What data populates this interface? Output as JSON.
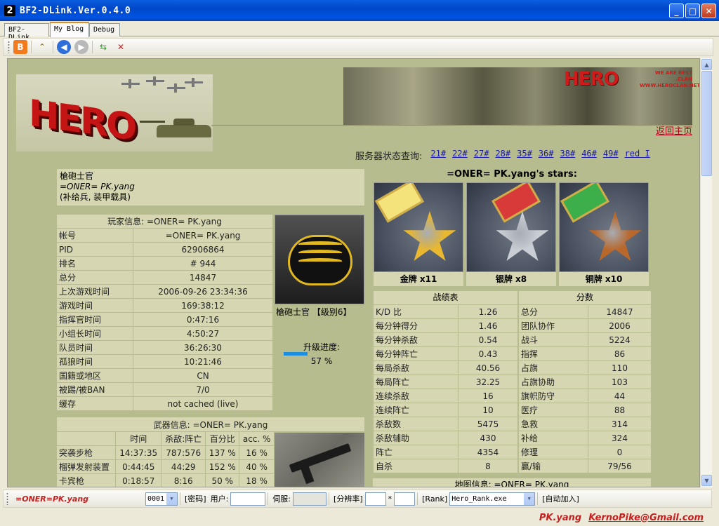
{
  "window": {
    "title": "BF2-DLink.Ver.0.4.0",
    "app_icon": "2"
  },
  "tabs": [
    {
      "label": "BF2-DLink"
    },
    {
      "label": "My Blog"
    },
    {
      "label": "Debug"
    }
  ],
  "banner": {
    "return_home": "返回主页",
    "hero_logo": "HERO",
    "hero_sub": "WE ARE BEST\n.CLAN\nWWW.HEROCLAN.NET"
  },
  "servers": {
    "label": "服务器状态查询:",
    "links": [
      "21#",
      "22#",
      "27#",
      "28#",
      "35#",
      "36#",
      "38#",
      "46#",
      "49#",
      "red I"
    ]
  },
  "rank": {
    "title": "槍砲士官",
    "player": "=ONER= PK.yang",
    "role": "(补给兵, 装甲载具)",
    "caption": "槍砲士官 【级别6】",
    "progress_label": "升级进度:",
    "progress_value": "57 %",
    "progress_fraction": 0.57
  },
  "player_info": {
    "header": "玩家信息:  =ONER= PK.yang",
    "rows": [
      [
        "帐号",
        "=ONER= PK.yang"
      ],
      [
        "PID",
        "62906864"
      ],
      [
        "排名",
        "# 944"
      ],
      [
        "总分",
        "14847"
      ],
      [
        "上次游戏时间",
        "2006-09-26 23:34:36"
      ],
      [
        "游戏时间",
        "169:38:12"
      ],
      [
        "指挥官时间",
        "0:47:16"
      ],
      [
        "小组长时间",
        "4:50:27"
      ],
      [
        "队员时间",
        "36:26:30"
      ],
      [
        "孤狼时间",
        "10:21:46"
      ],
      [
        "国籍或地区",
        "CN"
      ],
      [
        "被踢/被BAN",
        "7/0"
      ],
      [
        "缓存",
        "not cached (live)"
      ]
    ]
  },
  "weapons": {
    "title": "武器信息:  =ONER= PK.yang",
    "headers": [
      "",
      "时间",
      "杀敌:阵亡",
      "百分比",
      "acc. %"
    ],
    "rows": [
      [
        "突袭步枪",
        "14:37:35",
        "787:576",
        "137 %",
        "16 %"
      ],
      [
        "榴弹发射装置",
        "0:44:45",
        "44:29",
        "152 %",
        "40 %"
      ],
      [
        "卡宾枪",
        "0:18:57",
        "8:16",
        "50 %",
        "18 %"
      ]
    ]
  },
  "stars": {
    "title": "=ONER= PK.yang's stars:",
    "medals": [
      {
        "label": "金牌  x11",
        "color": "#e9b830",
        "ribbon": "#f4e27a"
      },
      {
        "label": "银牌  x8",
        "color": "#c9cdd4",
        "ribbon": "#d83a3a"
      },
      {
        "label": "铜牌  x10",
        "color": "#b9682c",
        "ribbon": "#3cae4a"
      }
    ]
  },
  "battle": {
    "title": "战绩表",
    "rows": [
      [
        "K/D 比",
        "1.26"
      ],
      [
        "每分钟得分",
        "1.46"
      ],
      [
        "每分钟杀敌",
        "0.54"
      ],
      [
        "每分钟阵亡",
        "0.43"
      ],
      [
        "每局杀敌",
        "40.56"
      ],
      [
        "每局阵亡",
        "32.25"
      ],
      [
        "连续杀敌",
        "16"
      ],
      [
        "连续阵亡",
        "10"
      ],
      [
        "杀敌数",
        "5475"
      ],
      [
        "杀敌辅助",
        "430"
      ],
      [
        "阵亡",
        "4354"
      ],
      [
        "自杀",
        "8"
      ]
    ]
  },
  "score": {
    "title": "分数",
    "rows": [
      [
        "总分",
        "14847"
      ],
      [
        "团队协作",
        "2006"
      ],
      [
        "战斗",
        "5224"
      ],
      [
        "指挥",
        "86"
      ],
      [
        "占旗",
        "110"
      ],
      [
        "占旗协助",
        "103"
      ],
      [
        "旗帜防守",
        "44"
      ],
      [
        "医疗",
        "88"
      ],
      [
        "急救",
        "314"
      ],
      [
        "补给",
        "324"
      ],
      [
        "修理",
        "0"
      ],
      [
        "赢/输",
        "79/56"
      ]
    ]
  },
  "map_info": {
    "title": "地图信息:  =ONER= PK.yang"
  },
  "bottombar": {
    "player": "=ONER=PK.yang",
    "server_num": "0001",
    "password_label": "[密码]",
    "user_label": "用户:",
    "server_label": "伺服:",
    "resolution_label": "[分辨率]",
    "times": "*",
    "rank_label": "[Rank]",
    "rank_exe": "Hero_Rank.exe",
    "autojoin_label": "[自动加入]"
  },
  "status": {
    "name": "PK.yang",
    "email": "KernoPike@Gmail.com"
  }
}
